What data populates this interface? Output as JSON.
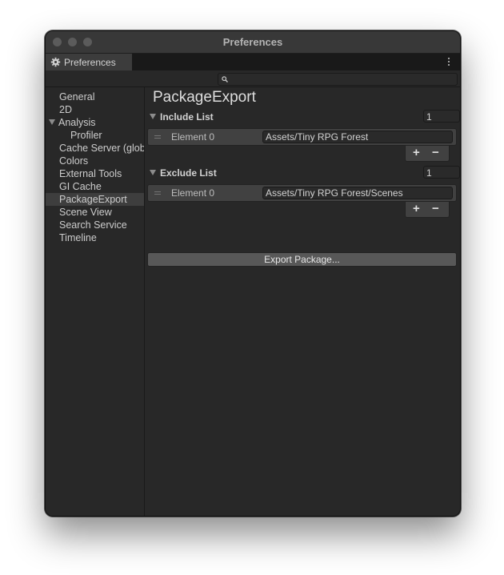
{
  "window": {
    "title": "Preferences"
  },
  "tab": {
    "label": "Preferences",
    "icon": "gear-icon"
  },
  "search": {
    "placeholder": "",
    "icon": "search-icon"
  },
  "sidebar": {
    "items": [
      {
        "label": "General"
      },
      {
        "label": "2D"
      },
      {
        "label": "Analysis"
      },
      {
        "label": "Profiler"
      },
      {
        "label": "Cache Server (global)"
      },
      {
        "label": "Colors"
      },
      {
        "label": "External Tools"
      },
      {
        "label": "GI Cache"
      },
      {
        "label": "PackageExport"
      },
      {
        "label": "Scene View"
      },
      {
        "label": "Search Service"
      },
      {
        "label": "Timeline"
      }
    ],
    "selected": "PackageExport"
  },
  "main": {
    "title": "PackageExport",
    "include": {
      "label": "Include List",
      "count": "1",
      "element_label": "Element 0",
      "element_value": "Assets/Tiny RPG Forest",
      "add_label": "+",
      "remove_label": "−"
    },
    "exclude": {
      "label": "Exclude List",
      "count": "1",
      "element_label": "Element 0",
      "element_value": "Assets/Tiny RPG Forest/Scenes",
      "add_label": "+",
      "remove_label": "−"
    },
    "export_button": "Export Package..."
  }
}
